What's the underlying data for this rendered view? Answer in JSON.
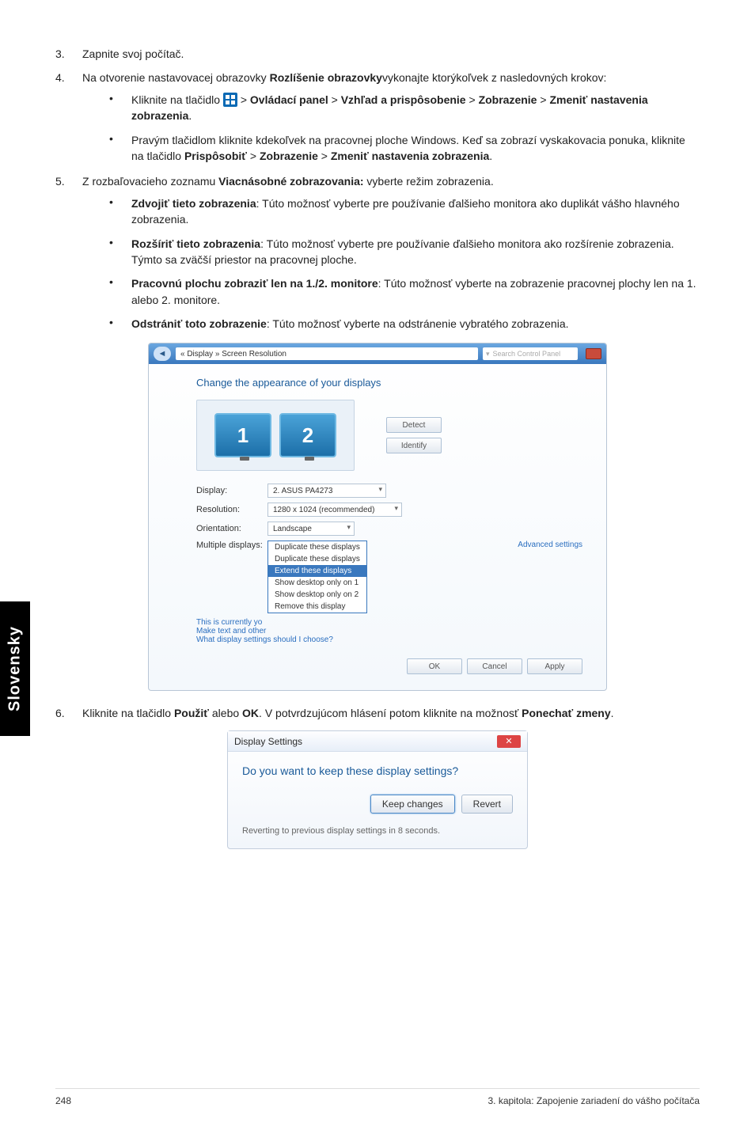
{
  "sidetab": "Slovensky",
  "steps": {
    "s3": {
      "num": "3.",
      "text": "Zapnite svoj počítač."
    },
    "s4": {
      "num": "4.",
      "lead1": "Na otvorenie nastavovacej obrazovky ",
      "bold1": "Rozlíšenie obrazovky",
      "lead2": "vykonajte ktorýkoľvek z nasledovných krokov:",
      "a": {
        "t1": "Kliknite na tlačidlo ",
        "t2": " > ",
        "b1": "Ovládací panel",
        "t3": " > ",
        "b2": "Vzhľad a prispôsobenie",
        "t4": " > ",
        "b3": "Zobrazenie",
        "t5": " > ",
        "b4": "Zmeniť nastavenia zobrazenia",
        "t6": "."
      },
      "b": {
        "t1": "Pravým tlačidlom kliknite kdekoľvek na pracovnej ploche Windows. Keď sa zobrazí vyskakovacia ponuka, kliknite na tlačidlo ",
        "b1": "Prispôsobiť",
        "t2": " > ",
        "b2": "Zobrazenie",
        "t3": " > ",
        "b3": "Zmeniť nastavenia zobrazenia",
        "t4": "."
      }
    },
    "s5": {
      "num": "5.",
      "t1": "Z rozbaľovacieho zoznamu ",
      "b1": "Viacnásobné zobrazovania:",
      "t2": " vyberte režim zobrazenia.",
      "opts": {
        "o1b": "Zdvojiť tieto zobrazenia",
        "o1t": ": Túto možnosť vyberte pre používanie ďalšieho monitora ako duplikát vášho hlavného zobrazenia.",
        "o2b": "Rozšíriť tieto zobrazenia",
        "o2t": ": Túto možnosť vyberte pre používanie ďalšieho monitora ako rozšírenie zobrazenia. Týmto sa zväčší priestor na pracovnej ploche.",
        "o3b": "Pracovnú plochu zobraziť len na 1./2. monitore",
        "o3t": ": Túto možnosť vyberte na zobrazenie pracovnej plochy len na 1. alebo 2. monitore.",
        "o4b": "Odstrániť toto zobrazenie",
        "o4t": ": Túto možnosť vyberte na odstránenie vybratého zobrazenia."
      }
    },
    "s6": {
      "num": "6.",
      "t1": "Kliknite na tlačidlo ",
      "b1": "Použiť",
      "t2": " alebo ",
      "b2": "OK",
      "t3": ". V potvrdzujúcom hlásení potom kliknite na možnosť ",
      "b3": "Ponechať zmeny",
      "t4": "."
    }
  },
  "win1": {
    "addr": "« Display » Screen Resolution",
    "search": "Search Control Panel",
    "heading": "Change the appearance of your displays",
    "mon1": "1",
    "mon2": "2",
    "btn_detect": "Detect",
    "btn_identify": "Identify",
    "rows": {
      "display": "Display:",
      "display_v": "2. ASUS PA4273",
      "res": "Resolution:",
      "res_v": "1280 x 1024 (recommended)",
      "orient": "Orientation:",
      "orient_v": "Landscape",
      "multi": "Multiple displays:"
    },
    "dd": {
      "o1": "Duplicate these displays",
      "o2": "Duplicate these displays",
      "o3": "Extend these displays",
      "o4": "Show desktop only on 1",
      "o5": "Show desktop only on 2",
      "o6": "Remove this display"
    },
    "note1": "This is currently yo",
    "note2": "Make text and other",
    "link": "Advanced settings",
    "note3": "What display settings should I choose?",
    "btn_ok": "OK",
    "btn_cancel": "Cancel",
    "btn_apply": "Apply"
  },
  "win2": {
    "title": "Display Settings",
    "q": "Do you want to keep these display settings?",
    "keep": "Keep changes",
    "revert": "Revert",
    "status": "Reverting to previous display settings in 8 seconds."
  },
  "footer": {
    "page": "248",
    "chapter": "3. kapitola: Zapojenie zariadení do vášho počítača"
  }
}
